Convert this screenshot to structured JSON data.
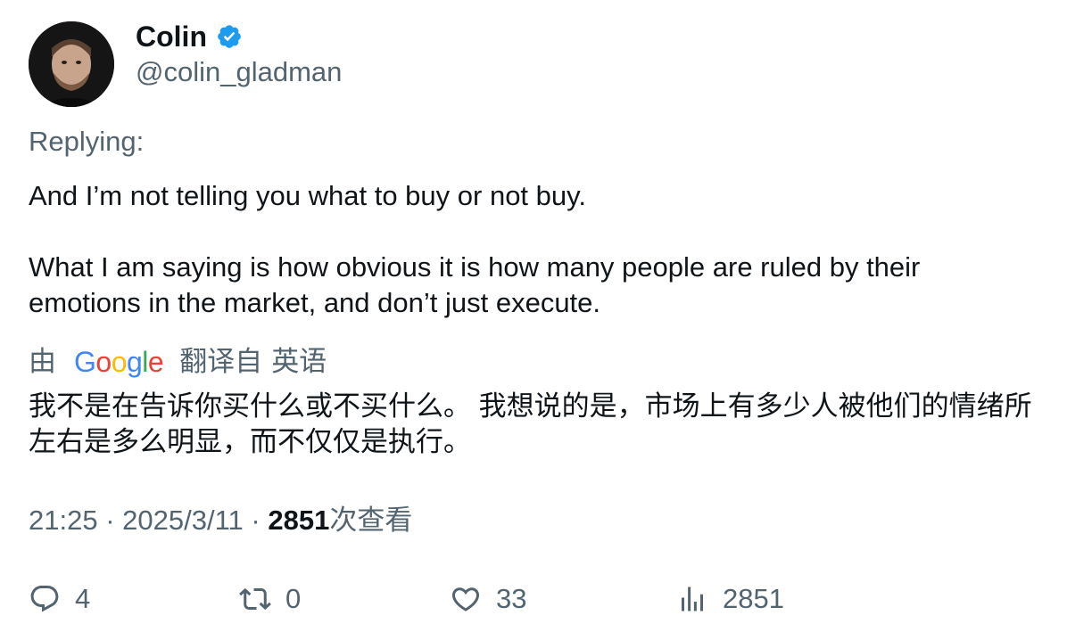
{
  "author": {
    "display_name": "Colin",
    "handle": "@colin_gladman",
    "verified_color": "#1d9bf0"
  },
  "replying_label": "Replying:",
  "tweet": {
    "paragraph_1": "And I’m not telling you what to buy or not buy.",
    "paragraph_2": "What I am saying is how obvious it is how many people are ruled by their emotions in the market, and don’t just execute."
  },
  "translation": {
    "prefix": "由",
    "provider_letters": [
      "G",
      "o",
      "o",
      "g",
      "l",
      "e"
    ],
    "translated_from": "翻译自",
    "language": "英语",
    "text": "我不是在告诉你买什么或不买什么。 我想说的是，市场上有多少人被他们的情绪所左右是多么明显，而不仅仅是执行。"
  },
  "meta": {
    "time": "21:25",
    "separator": "·",
    "date": "2025/3/11",
    "views_count": "2851",
    "views_label": "次查看"
  },
  "actions": {
    "reply_count": "4",
    "retweet_count": "0",
    "like_count": "33",
    "views_count": "2851"
  },
  "colors": {
    "primary_text": "#0f1419",
    "secondary_text": "#536471",
    "verified_blue": "#1d9bf0"
  }
}
